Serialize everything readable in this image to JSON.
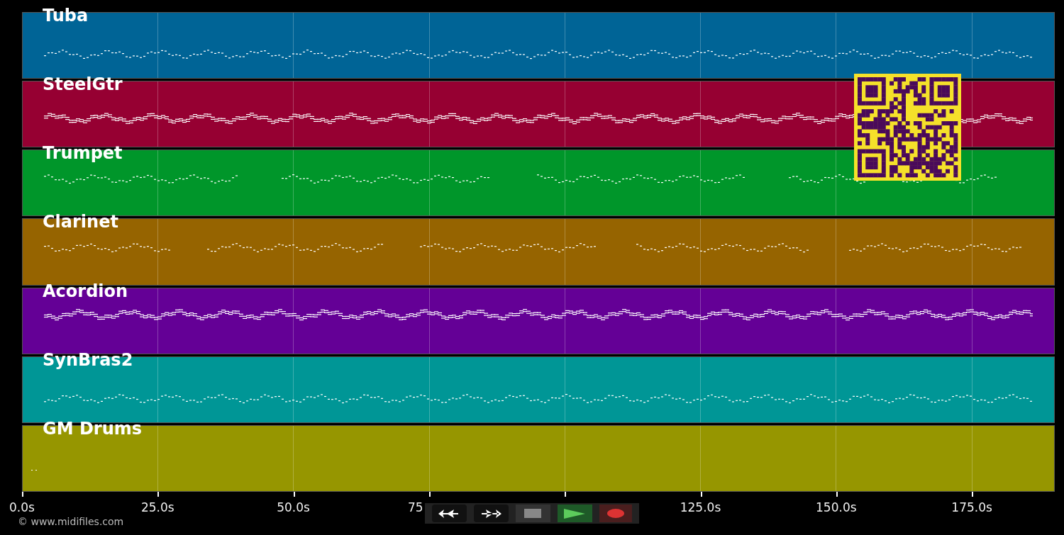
{
  "tracks": [
    {
      "name": "Tuba",
      "color": "#006496"
    },
    {
      "name": "SteelGtr",
      "color": "#960032"
    },
    {
      "name": "Trumpet",
      "color": "#00962a"
    },
    {
      "name": "Clarinet",
      "color": "#966400"
    },
    {
      "name": "Acordion",
      "color": "#640096"
    },
    {
      "name": "SynBras2",
      "color": "#009696"
    },
    {
      "name": "GM Drums",
      "color": "#969600"
    }
  ],
  "time_axis": {
    "ticks": [
      {
        "label": "0.0s"
      },
      {
        "label": "25.0s"
      },
      {
        "label": "50.0s"
      },
      {
        "label": "75"
      },
      {
        "label": "125.0s"
      },
      {
        "label": "150.0s"
      },
      {
        "label": "175.0s"
      }
    ]
  },
  "copyright": "© www.midifiles.com"
}
